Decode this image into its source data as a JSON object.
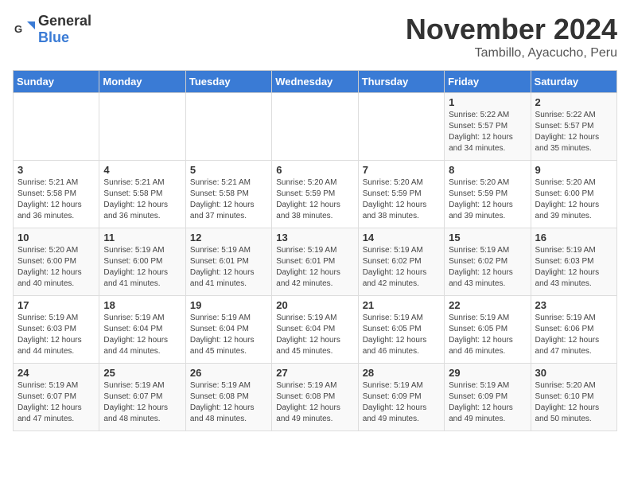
{
  "logo": {
    "general": "General",
    "blue": "Blue"
  },
  "header": {
    "month": "November 2024",
    "location": "Tambillo, Ayacucho, Peru"
  },
  "weekdays": [
    "Sunday",
    "Monday",
    "Tuesday",
    "Wednesday",
    "Thursday",
    "Friday",
    "Saturday"
  ],
  "weeks": [
    [
      {
        "day": "",
        "info": ""
      },
      {
        "day": "",
        "info": ""
      },
      {
        "day": "",
        "info": ""
      },
      {
        "day": "",
        "info": ""
      },
      {
        "day": "",
        "info": ""
      },
      {
        "day": "1",
        "info": "Sunrise: 5:22 AM\nSunset: 5:57 PM\nDaylight: 12 hours\nand 34 minutes."
      },
      {
        "day": "2",
        "info": "Sunrise: 5:22 AM\nSunset: 5:57 PM\nDaylight: 12 hours\nand 35 minutes."
      }
    ],
    [
      {
        "day": "3",
        "info": "Sunrise: 5:21 AM\nSunset: 5:58 PM\nDaylight: 12 hours\nand 36 minutes."
      },
      {
        "day": "4",
        "info": "Sunrise: 5:21 AM\nSunset: 5:58 PM\nDaylight: 12 hours\nand 36 minutes."
      },
      {
        "day": "5",
        "info": "Sunrise: 5:21 AM\nSunset: 5:58 PM\nDaylight: 12 hours\nand 37 minutes."
      },
      {
        "day": "6",
        "info": "Sunrise: 5:20 AM\nSunset: 5:59 PM\nDaylight: 12 hours\nand 38 minutes."
      },
      {
        "day": "7",
        "info": "Sunrise: 5:20 AM\nSunset: 5:59 PM\nDaylight: 12 hours\nand 38 minutes."
      },
      {
        "day": "8",
        "info": "Sunrise: 5:20 AM\nSunset: 5:59 PM\nDaylight: 12 hours\nand 39 minutes."
      },
      {
        "day": "9",
        "info": "Sunrise: 5:20 AM\nSunset: 6:00 PM\nDaylight: 12 hours\nand 39 minutes."
      }
    ],
    [
      {
        "day": "10",
        "info": "Sunrise: 5:20 AM\nSunset: 6:00 PM\nDaylight: 12 hours\nand 40 minutes."
      },
      {
        "day": "11",
        "info": "Sunrise: 5:19 AM\nSunset: 6:00 PM\nDaylight: 12 hours\nand 41 minutes."
      },
      {
        "day": "12",
        "info": "Sunrise: 5:19 AM\nSunset: 6:01 PM\nDaylight: 12 hours\nand 41 minutes."
      },
      {
        "day": "13",
        "info": "Sunrise: 5:19 AM\nSunset: 6:01 PM\nDaylight: 12 hours\nand 42 minutes."
      },
      {
        "day": "14",
        "info": "Sunrise: 5:19 AM\nSunset: 6:02 PM\nDaylight: 12 hours\nand 42 minutes."
      },
      {
        "day": "15",
        "info": "Sunrise: 5:19 AM\nSunset: 6:02 PM\nDaylight: 12 hours\nand 43 minutes."
      },
      {
        "day": "16",
        "info": "Sunrise: 5:19 AM\nSunset: 6:03 PM\nDaylight: 12 hours\nand 43 minutes."
      }
    ],
    [
      {
        "day": "17",
        "info": "Sunrise: 5:19 AM\nSunset: 6:03 PM\nDaylight: 12 hours\nand 44 minutes."
      },
      {
        "day": "18",
        "info": "Sunrise: 5:19 AM\nSunset: 6:04 PM\nDaylight: 12 hours\nand 44 minutes."
      },
      {
        "day": "19",
        "info": "Sunrise: 5:19 AM\nSunset: 6:04 PM\nDaylight: 12 hours\nand 45 minutes."
      },
      {
        "day": "20",
        "info": "Sunrise: 5:19 AM\nSunset: 6:04 PM\nDaylight: 12 hours\nand 45 minutes."
      },
      {
        "day": "21",
        "info": "Sunrise: 5:19 AM\nSunset: 6:05 PM\nDaylight: 12 hours\nand 46 minutes."
      },
      {
        "day": "22",
        "info": "Sunrise: 5:19 AM\nSunset: 6:05 PM\nDaylight: 12 hours\nand 46 minutes."
      },
      {
        "day": "23",
        "info": "Sunrise: 5:19 AM\nSunset: 6:06 PM\nDaylight: 12 hours\nand 47 minutes."
      }
    ],
    [
      {
        "day": "24",
        "info": "Sunrise: 5:19 AM\nSunset: 6:07 PM\nDaylight: 12 hours\nand 47 minutes."
      },
      {
        "day": "25",
        "info": "Sunrise: 5:19 AM\nSunset: 6:07 PM\nDaylight: 12 hours\nand 48 minutes."
      },
      {
        "day": "26",
        "info": "Sunrise: 5:19 AM\nSunset: 6:08 PM\nDaylight: 12 hours\nand 48 minutes."
      },
      {
        "day": "27",
        "info": "Sunrise: 5:19 AM\nSunset: 6:08 PM\nDaylight: 12 hours\nand 49 minutes."
      },
      {
        "day": "28",
        "info": "Sunrise: 5:19 AM\nSunset: 6:09 PM\nDaylight: 12 hours\nand 49 minutes."
      },
      {
        "day": "29",
        "info": "Sunrise: 5:19 AM\nSunset: 6:09 PM\nDaylight: 12 hours\nand 49 minutes."
      },
      {
        "day": "30",
        "info": "Sunrise: 5:20 AM\nSunset: 6:10 PM\nDaylight: 12 hours\nand 50 minutes."
      }
    ]
  ]
}
